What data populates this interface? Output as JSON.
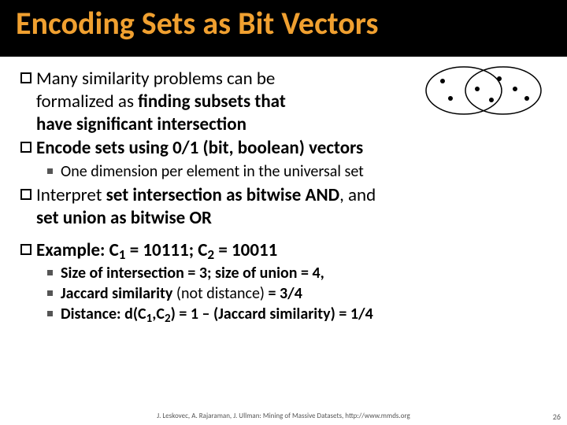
{
  "title": "Encoding Sets as Bit Vectors",
  "bullets": {
    "b1_lead": "Many similarity problems can be",
    "b1_line2": "formalized as ",
    "b1_bold1": "finding subsets that",
    "b1_bold2": "have significant intersection",
    "b2": "Encode sets using 0/1 (bit, boolean) vectors",
    "b2_sub1": "One dimension per element in the universal set",
    "b3_lead": "Interpret ",
    "b3_part1": "set intersection as bitwise AND",
    "b3_mid": ", and ",
    "b3_part2": "set union as bitwise OR",
    "b4_lead": "Example: ",
    "b4_rest_a": "C",
    "b4_s1": "1",
    "b4_eq1": " = 10111; ",
    "b4_s2": "2",
    "b4_eq2": " = 10011",
    "b4_sub1": "Size of intersection = 3; size of union = 4,",
    "b4_sub2_a": "Jaccard similarity",
    "b4_sub2_b": " (not distance) ",
    "b4_sub2_c": "= 3/4",
    "b4_sub3_a": "Distance: d(C",
    "b4_sub3_s1": "1",
    "b4_sub3_b": ",C",
    "b4_sub3_s2": "2",
    "b4_sub3_c": ") = 1 – (Jaccard similarity) = 1/4"
  },
  "footer": "J. Leskovec, A. Rajaraman, J. Ullman: Mining of Massive Datasets, http://www.mmds.org",
  "page": "26"
}
